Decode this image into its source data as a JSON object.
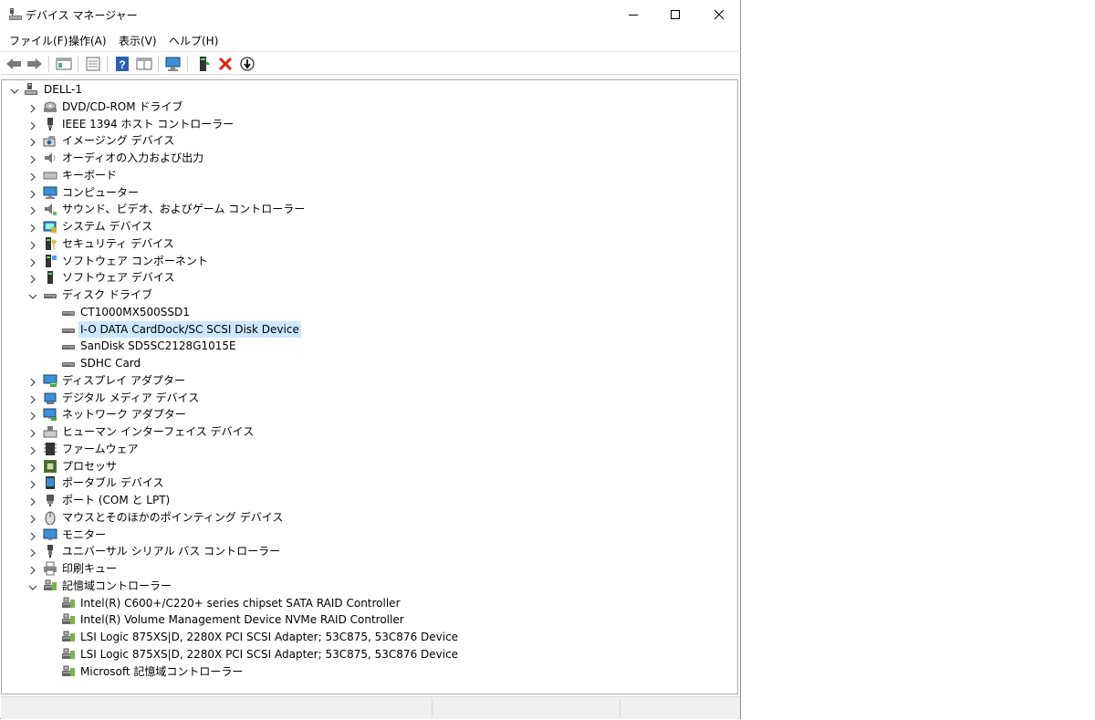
{
  "window": {
    "title": "デバイス マネージャー",
    "controls": {
      "minimize": "minimize-icon",
      "maximize": "maximize-icon",
      "close": "close-icon"
    }
  },
  "menu": [
    "ファイル(F)",
    "操作(A)",
    "表示(V)",
    "ヘルプ(H)"
  ],
  "toolbar": [
    "back-arrow-icon",
    "forward-arrow-icon",
    "show-hide-tree-icon",
    "properties-icon",
    "help-icon",
    "view-icon",
    "scan-hardware-icon",
    "enable-device-icon",
    "uninstall-icon",
    "update-driver-icon"
  ],
  "tree": {
    "root": "DELL-1",
    "categories": [
      {
        "label": "DVD/CD-ROM ドライブ",
        "icon": "optical-drive-icon"
      },
      {
        "label": "IEEE 1394 ホスト コントローラー",
        "icon": "ieee1394-icon"
      },
      {
        "label": "イメージング デバイス",
        "icon": "camera-icon"
      },
      {
        "label": "オーディオの入力および出力",
        "icon": "speaker-icon"
      },
      {
        "label": "キーボード",
        "icon": "keyboard-icon"
      },
      {
        "label": "コンピューター",
        "icon": "computer-icon"
      },
      {
        "label": "サウンド、ビデオ、およびゲーム コントローラー",
        "icon": "sound-icon"
      },
      {
        "label": "システム デバイス",
        "icon": "system-folder-icon"
      },
      {
        "label": "セキュリティ デバイス",
        "icon": "security-key-icon"
      },
      {
        "label": "ソフトウェア コンポーネント",
        "icon": "software-component-icon"
      },
      {
        "label": "ソフトウェア デバイス",
        "icon": "software-device-icon"
      },
      {
        "label": "ディスク ドライブ",
        "icon": "disk-drive-icon",
        "expanded": true,
        "children": [
          {
            "label": "CT1000MX500SSD1",
            "icon": "disk-drive-icon"
          },
          {
            "label": "I-O DATA CardDock/SC SCSI Disk Device",
            "icon": "disk-drive-icon",
            "selected": true
          },
          {
            "label": "SanDisk SD5SC2128G1015E",
            "icon": "disk-drive-icon"
          },
          {
            "label": "SDHC Card",
            "icon": "disk-drive-icon"
          }
        ]
      },
      {
        "label": "ディスプレイ アダプター",
        "icon": "display-adapter-icon"
      },
      {
        "label": "デジタル メディア デバイス",
        "icon": "media-device-icon"
      },
      {
        "label": "ネットワーク アダプター",
        "icon": "network-icon"
      },
      {
        "label": "ヒューマン インターフェイス デバイス",
        "icon": "hid-icon"
      },
      {
        "label": "ファームウェア",
        "icon": "firmware-icon"
      },
      {
        "label": "プロセッサ",
        "icon": "processor-icon"
      },
      {
        "label": "ポータブル デバイス",
        "icon": "portable-device-icon"
      },
      {
        "label": "ポート (COM と LPT)",
        "icon": "port-icon"
      },
      {
        "label": "マウスとそのほかのポインティング デバイス",
        "icon": "mouse-icon"
      },
      {
        "label": "モニター",
        "icon": "monitor-icon"
      },
      {
        "label": "ユニバーサル シリアル バス コントローラー",
        "icon": "usb-icon"
      },
      {
        "label": "印刷キュー",
        "icon": "printer-icon"
      },
      {
        "label": "記憶域コントローラー",
        "icon": "storage-controller-icon",
        "expanded": true,
        "children": [
          {
            "label": "Intel(R) C600+/C220+ series chipset SATA RAID Controller",
            "icon": "storage-controller-icon"
          },
          {
            "label": "Intel(R) Volume Management Device NVMe RAID Controller",
            "icon": "storage-controller-icon"
          },
          {
            "label": "LSI Logic 875XS|D, 2280X PCI SCSI Adapter; 53C875, 53C876 Device",
            "icon": "storage-controller-icon"
          },
          {
            "label": "LSI Logic 875XS|D, 2280X PCI SCSI Adapter; 53C875, 53C876 Device",
            "icon": "storage-controller-icon"
          },
          {
            "label": "Microsoft 記憶域コントローラー",
            "icon": "storage-controller-icon"
          }
        ]
      }
    ]
  },
  "colors": {
    "selection": "#cce8ff",
    "accent": "#1f6fd6"
  }
}
